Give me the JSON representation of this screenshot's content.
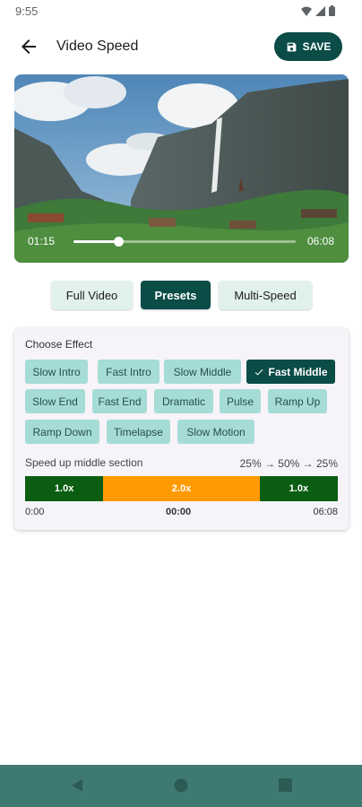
{
  "status": {
    "time": "9:55"
  },
  "app_bar": {
    "title": "Video Speed",
    "save_label": "SAVE"
  },
  "video": {
    "current_time": "01:15",
    "total_time": "06:08",
    "progress": 0.2
  },
  "mode_tabs": [
    {
      "label": "Full Video",
      "active": false
    },
    {
      "label": "Presets",
      "active": true
    },
    {
      "label": "Multi-Speed",
      "active": false
    }
  ],
  "effects": {
    "heading": "Choose Effect",
    "chips": [
      {
        "label": "Slow Intro",
        "selected": false
      },
      {
        "label": "Fast Intro",
        "selected": false
      },
      {
        "label": "Slow Middle",
        "selected": false
      },
      {
        "label": "Fast Middle",
        "selected": true
      },
      {
        "label": "Slow End",
        "selected": false
      },
      {
        "label": "Fast End",
        "selected": false
      },
      {
        "label": "Dramatic",
        "selected": false
      },
      {
        "label": "Pulse",
        "selected": false
      },
      {
        "label": "Ramp Up",
        "selected": false
      },
      {
        "label": "Ramp Down",
        "selected": false
      },
      {
        "label": "Timelapse",
        "selected": false
      },
      {
        "label": "Slow Motion",
        "selected": false
      }
    ],
    "description": "Speed up middle section",
    "progression": "25% → 50% → 25%",
    "segments": [
      {
        "label": "1.0x",
        "share": 0.25,
        "color": "#0b5d12"
      },
      {
        "label": "2.0x",
        "share": 0.5,
        "color": "#ff9a00"
      },
      {
        "label": "1.0x",
        "share": 0.25,
        "color": "#0b5d12"
      }
    ],
    "timeline": {
      "start": "0:00",
      "middle": "00:00",
      "end": "06:08"
    }
  },
  "colors": {
    "accent": "#0b4c47",
    "chip": "#a6dcd6",
    "nav": "#3f7a72"
  }
}
